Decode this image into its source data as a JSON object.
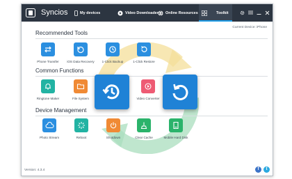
{
  "app": {
    "title": "Syncios"
  },
  "nav": {
    "my_devices": "My devices",
    "video_downloader": "Video Downloader",
    "online_resources": "Online Resources",
    "toolkit": "Toolkit"
  },
  "device_line": "Current Device: iPhone",
  "sections": {
    "recommended": {
      "title": "Recommended Tools",
      "items": [
        {
          "label": "Phone Transfer",
          "icon": "transfer-arrows-icon"
        },
        {
          "label": "iOS Data Recovery",
          "icon": "data-recovery-icon"
        },
        {
          "label": "1-Click Backup",
          "icon": "backup-clock-icon"
        },
        {
          "label": "1-Click Restore",
          "icon": "restore-arrow-icon"
        }
      ]
    },
    "common": {
      "title": "Common Functions",
      "items": [
        {
          "label": "Ringtone Maker",
          "icon": "bell-icon"
        },
        {
          "label": "File System",
          "icon": "folder-icon"
        },
        {
          "label": "",
          "icon": "gif-icon"
        },
        {
          "label": "Video Converter",
          "icon": "video-convert-icon"
        }
      ]
    },
    "device": {
      "title": "Device Management",
      "items": [
        {
          "label": "Photo Stream",
          "icon": "cloud-icon"
        },
        {
          "label": "Reboot",
          "icon": "reboot-spinner-icon"
        },
        {
          "label": "Shutdown",
          "icon": "power-icon"
        },
        {
          "label": "Clear Cache",
          "icon": "broom-icon"
        },
        {
          "label": "Mobile Hard Disk",
          "icon": "hard-disk-icon"
        }
      ]
    }
  },
  "version": "Version: 4.3.4",
  "colors": {
    "titlebar": "#2c3541",
    "accent_blue": "#1f82d6",
    "tile_blue": "#2b8fe0",
    "tile_teal": "#22b3a3",
    "tile_orange": "#f08a35",
    "tile_pink": "#ee5b74",
    "tile_green": "#2bb36b",
    "facebook": "#3b73c7",
    "twitter": "#2aa9e0"
  }
}
